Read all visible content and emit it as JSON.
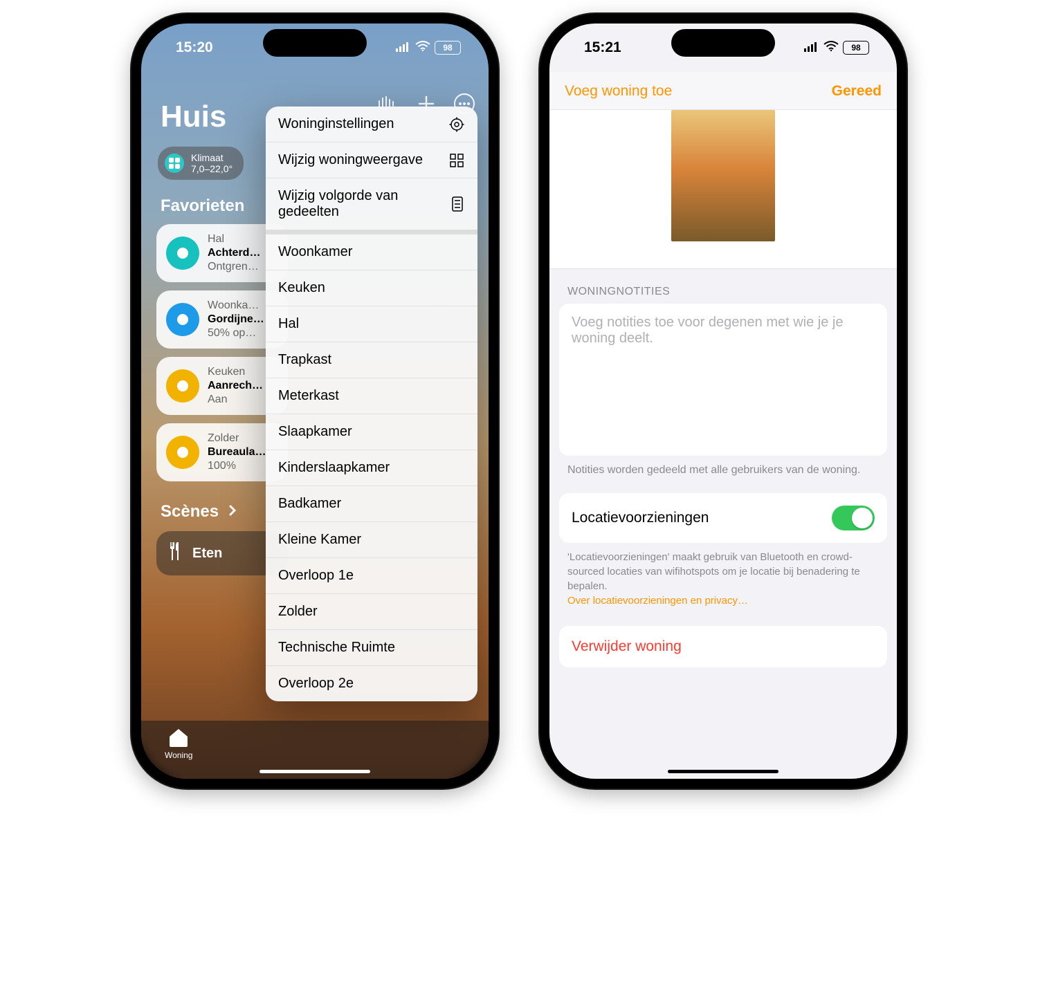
{
  "left": {
    "status": {
      "time": "15:20",
      "battery": "98"
    },
    "title": "Huis",
    "climate": {
      "label": "Klimaat",
      "range": "7,0–22,0°"
    },
    "favorites_header": "Favorieten",
    "favorites": [
      {
        "room": "Hal",
        "name": "Achterd…",
        "state": "Ontgren…",
        "color": "#17c1bd"
      },
      {
        "room": "Woonka…",
        "name": "Gordijne…",
        "state": "50% op…",
        "color": "#1e9be8"
      },
      {
        "room": "Keuken",
        "name": "Aanrech…",
        "state": "Aan",
        "color": "#f2b200"
      },
      {
        "room": "Zolder",
        "name": "Bureaula…",
        "state": "100%",
        "color": "#f2b200"
      }
    ],
    "scenes_header": "Scènes",
    "scene": "Eten",
    "tab": "Woning",
    "menu": {
      "top": [
        {
          "label": "Woninginstellingen",
          "icon": "gear"
        },
        {
          "label": "Wijzig woningweergave",
          "icon": "grid"
        },
        {
          "label": "Wijzig volgorde van gedeelten",
          "icon": "list"
        }
      ],
      "rooms": [
        "Woonkamer",
        "Keuken",
        "Hal",
        "Trapkast",
        "Meterkast",
        "Slaapkamer",
        "Kinderslaapkamer",
        "Badkamer",
        "Kleine Kamer",
        "Overloop 1e",
        "Zolder",
        "Technische Ruimte",
        "Overloop 2e"
      ]
    }
  },
  "right": {
    "status": {
      "time": "15:21",
      "battery": "98"
    },
    "header": {
      "left": "Voeg woning toe",
      "right": "Gereed"
    },
    "notes": {
      "group_label": "WONINGNOTITIES",
      "placeholder": "Voeg notities toe voor degenen met wie je je woning deelt.",
      "footer": "Notities worden gedeeld met alle gebruikers van de woning."
    },
    "location": {
      "label": "Locatievoorzieningen",
      "on": true,
      "footer": "'Locatievoorzieningen' maakt gebruik van Bluetooth en crowd-sourced locaties van wifihotspots om je locatie bij benadering te bepalen.",
      "link": "Over locatievoorzieningen en privacy…"
    },
    "delete": "Verwijder woning"
  }
}
